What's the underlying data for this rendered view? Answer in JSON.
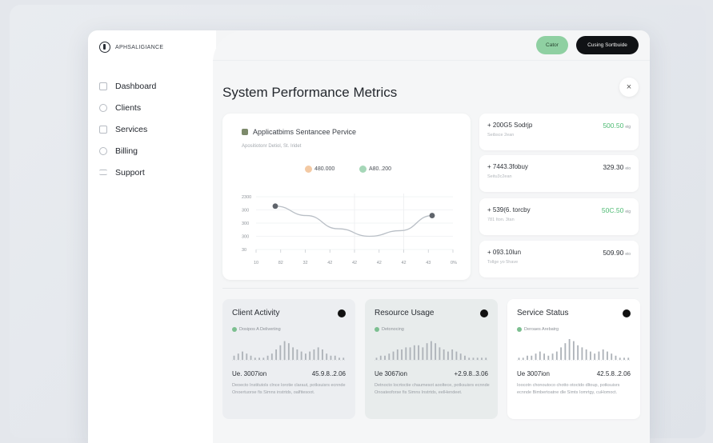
{
  "brand": {
    "name": "APHSALIGIANCE"
  },
  "sidebar": {
    "items": [
      {
        "label": "Dashboard"
      },
      {
        "label": "Clients"
      },
      {
        "label": "Services"
      },
      {
        "label": "Billing"
      },
      {
        "label": "Support"
      }
    ]
  },
  "topbar": {
    "green_button": "Cator",
    "dark_button": "Cusing Sortbuide"
  },
  "page": {
    "title": "System Performance Metrics",
    "close": "×"
  },
  "chart_card": {
    "title": "Applicatbims Sentancee Pervice",
    "subtitle": "Apositiotonr Detiol, St. Iridet",
    "pills": [
      {
        "label": "480.000"
      },
      {
        "label": "A80..200"
      }
    ]
  },
  "chart_data": {
    "type": "line",
    "x_ticks": [
      "10",
      "82",
      "32",
      "42",
      "42",
      "42",
      "42",
      "43",
      "0%"
    ],
    "y_ticks": [
      "2300",
      "300",
      "300",
      "300",
      "30"
    ],
    "series": [
      {
        "values": [
          2150,
          1900,
          1550,
          1350,
          1500,
          1900
        ]
      }
    ],
    "markers": [
      {
        "x_index": 0,
        "y": 2150
      },
      {
        "x_index": 5,
        "y": 1900
      }
    ],
    "ylim": [
      1000,
      2400
    ],
    "grid": true
  },
  "stats": [
    {
      "label": "+ 200G5 Sodrjp",
      "sub": "Seibsce 2ean",
      "value": "500.50",
      "unit": "eig",
      "tone": "green"
    },
    {
      "label": "+ 7443.3fobuy",
      "sub": "Seitu3c2ean",
      "value": "329.30",
      "unit": "eio",
      "tone": "dark"
    },
    {
      "label": "+ 539(6. torcby",
      "sub": "781 Iton. 3tan",
      "value": "50C.50",
      "unit": "eig",
      "tone": "green"
    },
    {
      "label": "+ 093.10lun",
      "sub": "Tollge yo 5have",
      "value": "509.90",
      "unit": "eio",
      "tone": "dark"
    }
  ],
  "cards": [
    {
      "title": "Client Activity",
      "tag": "Dosipos A Deliveriing",
      "left": "Ue. 3007ion",
      "right": "45.9.8..2.06",
      "desc": "Deoecto Institutols clnce lorotie claraut, potksuisrs ecnnde Onoertuorse fis Simns instrtds, oalfitesoot.",
      "bars": [
        2,
        3,
        4,
        3,
        2,
        1,
        1,
        1,
        2,
        3,
        5,
        7,
        9,
        8,
        6,
        5,
        4,
        3,
        4,
        5,
        6,
        5,
        3,
        2,
        2,
        1,
        1
      ]
    },
    {
      "title": "Resource Usage",
      "tag": "Detonocing",
      "left": "Ue 3067ion",
      "right": "+2.9.8..3.06",
      "desc": "Detnocto locrtoctie chaumesot aooltece, potksuisrs ecnnde Onoateoforse fis Simns Instrtds, eelHendeet.",
      "bars": [
        1,
        2,
        2,
        3,
        4,
        5,
        5,
        6,
        6,
        7,
        7,
        6,
        8,
        9,
        8,
        6,
        5,
        4,
        5,
        4,
        3,
        2,
        1,
        1,
        1,
        1,
        1
      ]
    },
    {
      "title": "Service Status",
      "tag": "Deroaes Arebatrg",
      "left": "Ue 3007ion",
      "right": "42.5.8..2.06",
      "desc": "Ioocotn chonoutoco chotto otoctdo dltoup, potksuisrs ecnnde Bimbertoatne dle Simts Iomrtgy, cuHomoct.",
      "bars": [
        1,
        1,
        2,
        2,
        3,
        4,
        3,
        2,
        3,
        4,
        6,
        8,
        10,
        9,
        7,
        6,
        5,
        4,
        3,
        4,
        5,
        4,
        3,
        2,
        1,
        1,
        1
      ]
    }
  ],
  "colors": {
    "accent_green": "#4dba72",
    "button_green": "#8fd0a2",
    "dark": "#101215"
  }
}
